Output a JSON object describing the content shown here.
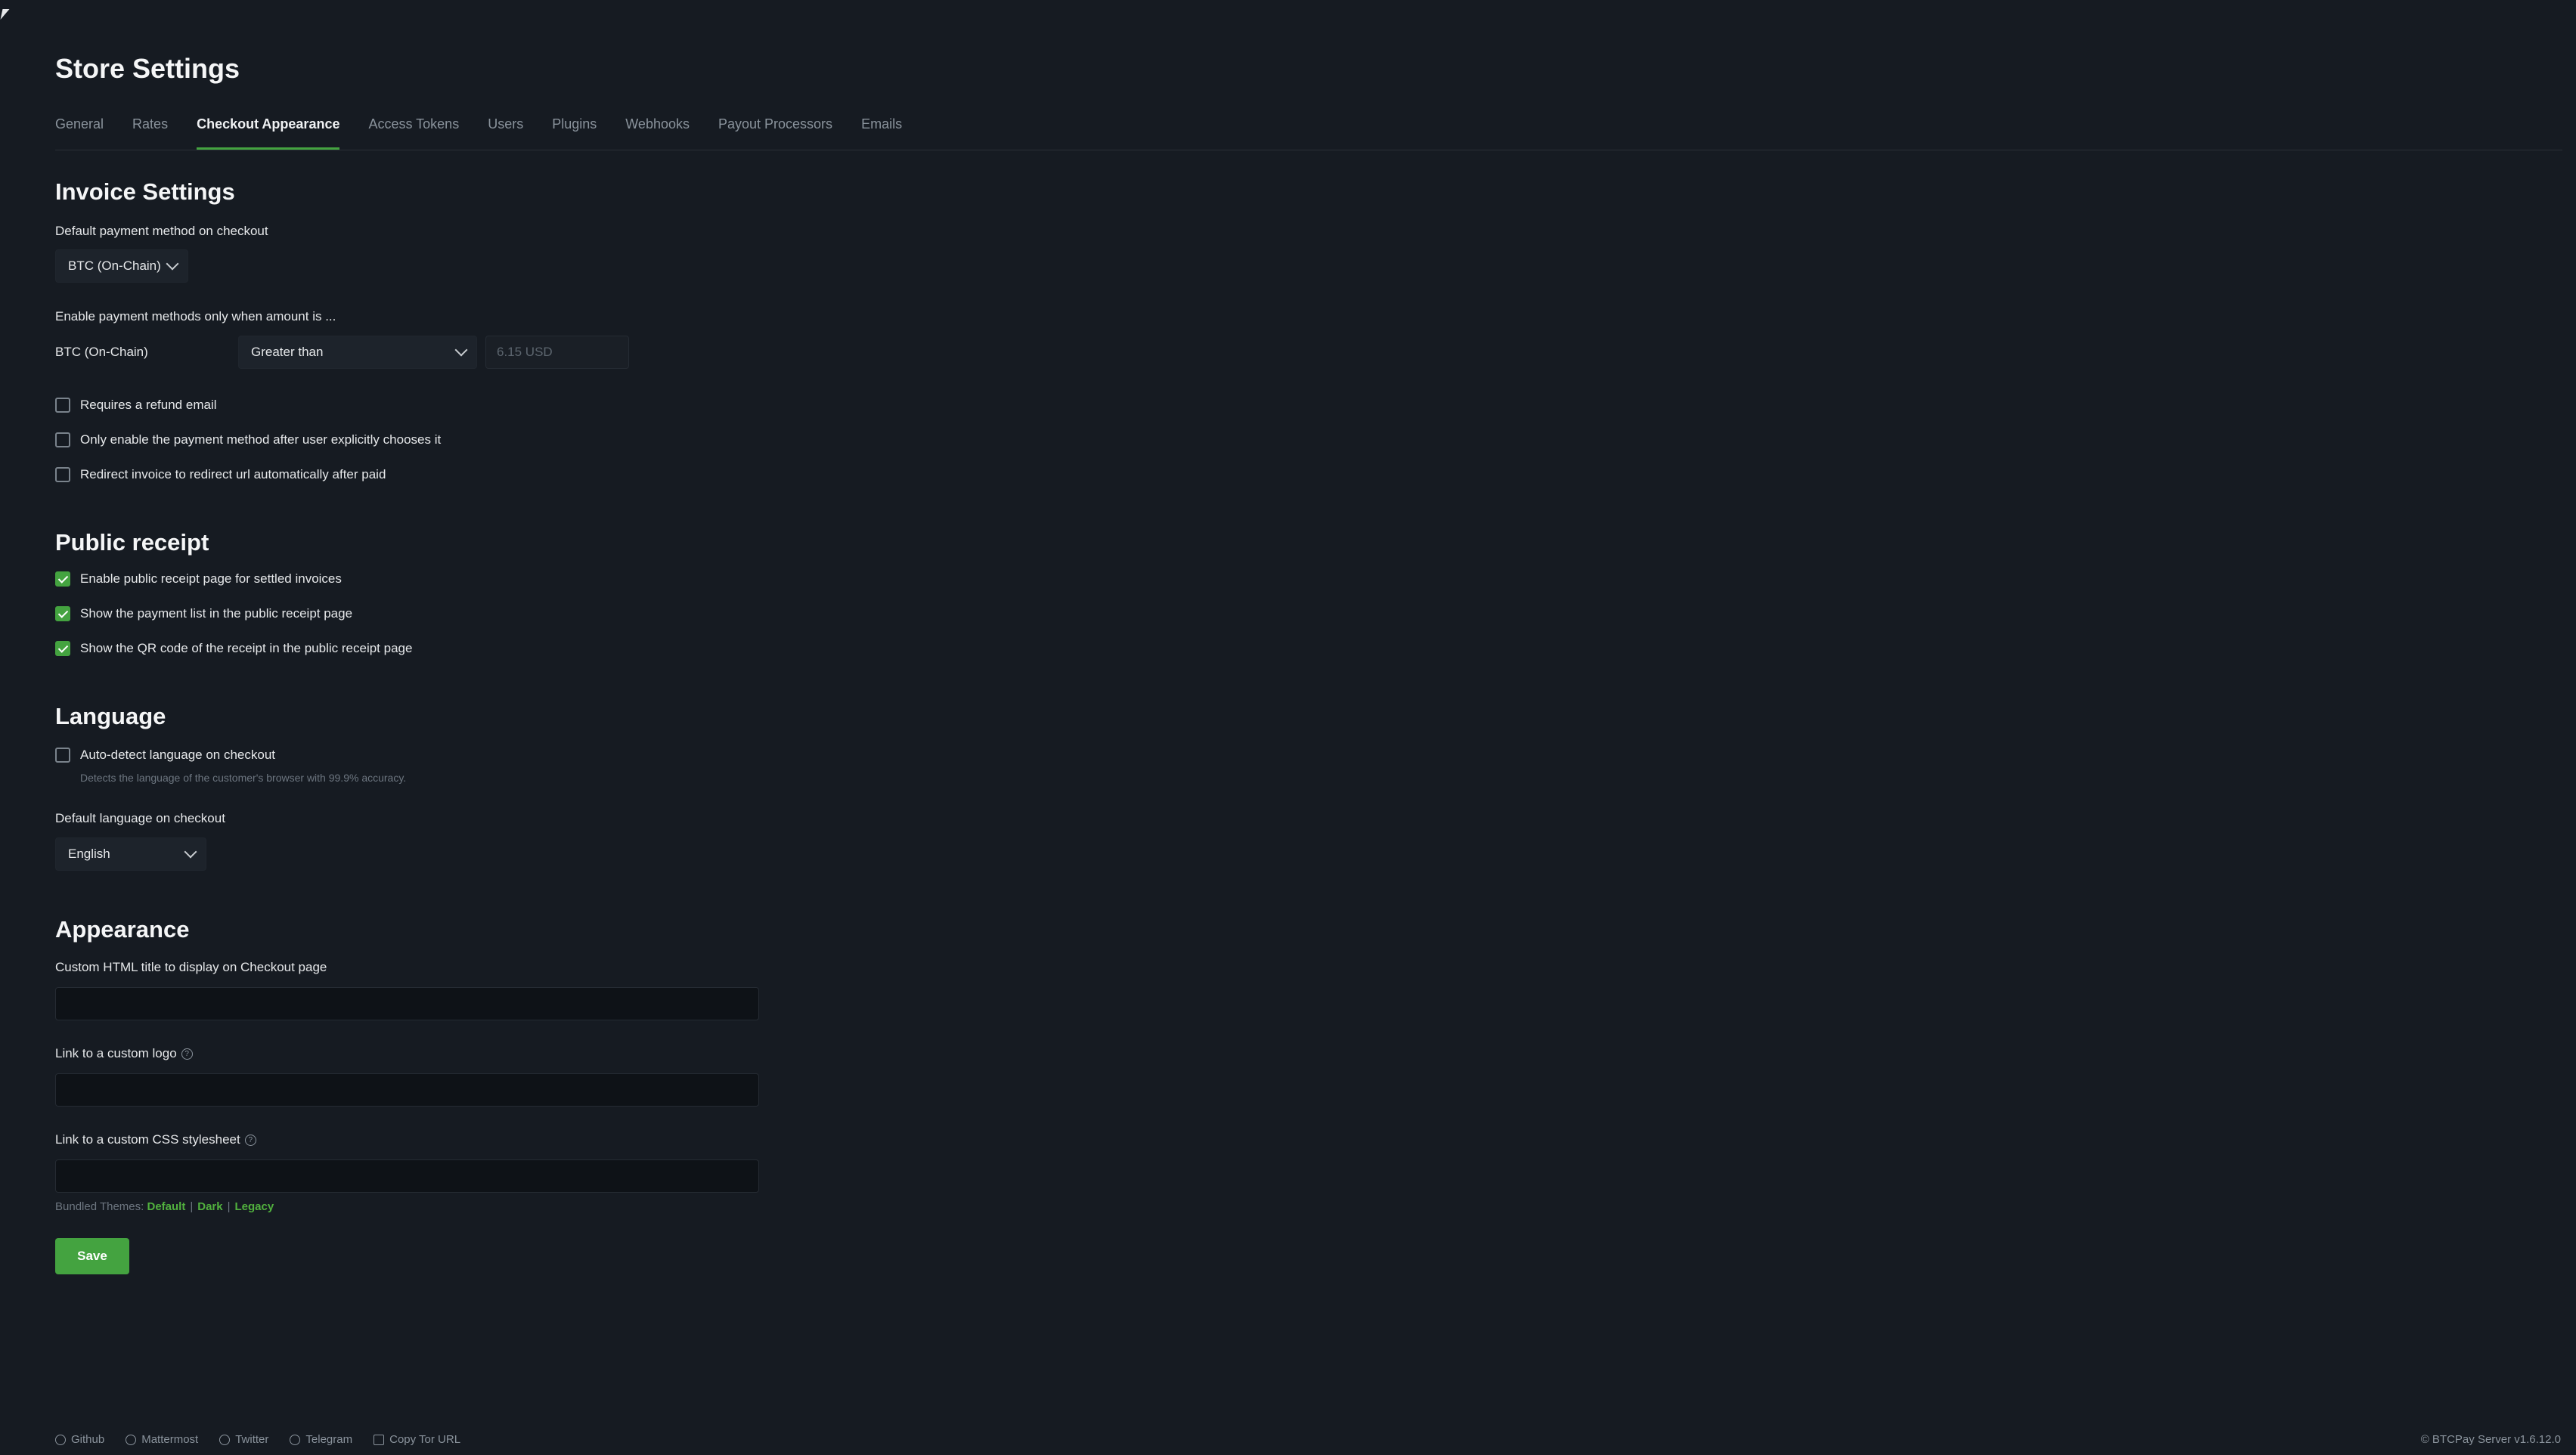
{
  "title": "Store Settings",
  "tabs": [
    {
      "label": "General"
    },
    {
      "label": "Rates"
    },
    {
      "label": "Checkout Appearance"
    },
    {
      "label": "Access Tokens"
    },
    {
      "label": "Users"
    },
    {
      "label": "Plugins"
    },
    {
      "label": "Webhooks"
    },
    {
      "label": "Payout Processors"
    },
    {
      "label": "Emails"
    }
  ],
  "invoice": {
    "heading": "Invoice Settings",
    "default_method_label": "Default payment method on checkout",
    "default_method_value": "BTC (On-Chain)",
    "enable_when_label": "Enable payment methods only when amount is ...",
    "rule_method": "BTC (On-Chain)",
    "rule_condition": "Greater than",
    "rule_amount_placeholder": "6.15 USD",
    "checks": [
      {
        "label": "Requires a refund email",
        "checked": false
      },
      {
        "label": "Only enable the payment method after user explicitly chooses it",
        "checked": false
      },
      {
        "label": "Redirect invoice to redirect url automatically after paid",
        "checked": false
      }
    ]
  },
  "receipt": {
    "heading": "Public receipt",
    "checks": [
      {
        "label": "Enable public receipt page for settled invoices",
        "checked": true
      },
      {
        "label": "Show the payment list in the public receipt page",
        "checked": true
      },
      {
        "label": "Show the QR code of the receipt in the public receipt page",
        "checked": true
      }
    ]
  },
  "language": {
    "heading": "Language",
    "auto_detect_label": "Auto-detect language on checkout",
    "auto_detect_checked": false,
    "auto_detect_help": "Detects the language of the customer's browser with 99.9% accuracy.",
    "default_label": "Default language on checkout",
    "default_value": "English"
  },
  "appearance": {
    "heading": "Appearance",
    "html_title_label": "Custom HTML title to display on Checkout page",
    "logo_label": "Link to a custom logo",
    "css_label": "Link to a custom CSS stylesheet",
    "themes_prefix": "Bundled Themes:",
    "themes": [
      "Default",
      "Dark",
      "Legacy"
    ],
    "save_label": "Save"
  },
  "footer": {
    "links": [
      {
        "label": "Github",
        "icon": "github-icon"
      },
      {
        "label": "Mattermost",
        "icon": "mattermost-icon"
      },
      {
        "label": "Twitter",
        "icon": "twitter-icon"
      },
      {
        "label": "Telegram",
        "icon": "telegram-icon"
      },
      {
        "label": "Copy Tor URL",
        "icon": "tor-icon"
      }
    ],
    "version": "© BTCPay Server v1.6.12.0"
  },
  "colors": {
    "accent": "#44a340",
    "background": "#161b22"
  }
}
